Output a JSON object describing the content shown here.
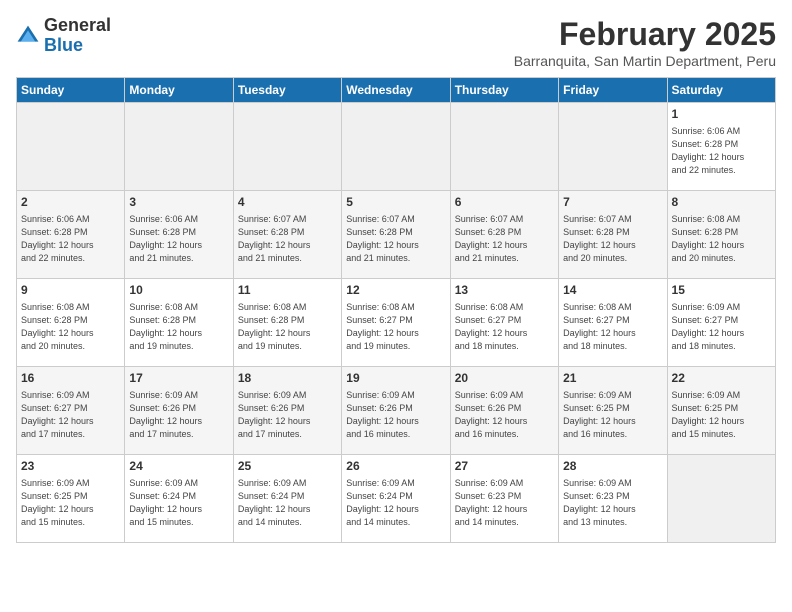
{
  "header": {
    "logo_general": "General",
    "logo_blue": "Blue",
    "month_title": "February 2025",
    "location": "Barranquita, San Martin Department, Peru"
  },
  "days_of_week": [
    "Sunday",
    "Monday",
    "Tuesday",
    "Wednesday",
    "Thursday",
    "Friday",
    "Saturday"
  ],
  "weeks": [
    [
      {
        "day": "",
        "info": ""
      },
      {
        "day": "",
        "info": ""
      },
      {
        "day": "",
        "info": ""
      },
      {
        "day": "",
        "info": ""
      },
      {
        "day": "",
        "info": ""
      },
      {
        "day": "",
        "info": ""
      },
      {
        "day": "1",
        "info": "Sunrise: 6:06 AM\nSunset: 6:28 PM\nDaylight: 12 hours\nand 22 minutes."
      }
    ],
    [
      {
        "day": "2",
        "info": "Sunrise: 6:06 AM\nSunset: 6:28 PM\nDaylight: 12 hours\nand 22 minutes."
      },
      {
        "day": "3",
        "info": "Sunrise: 6:06 AM\nSunset: 6:28 PM\nDaylight: 12 hours\nand 21 minutes."
      },
      {
        "day": "4",
        "info": "Sunrise: 6:07 AM\nSunset: 6:28 PM\nDaylight: 12 hours\nand 21 minutes."
      },
      {
        "day": "5",
        "info": "Sunrise: 6:07 AM\nSunset: 6:28 PM\nDaylight: 12 hours\nand 21 minutes."
      },
      {
        "day": "6",
        "info": "Sunrise: 6:07 AM\nSunset: 6:28 PM\nDaylight: 12 hours\nand 21 minutes."
      },
      {
        "day": "7",
        "info": "Sunrise: 6:07 AM\nSunset: 6:28 PM\nDaylight: 12 hours\nand 20 minutes."
      },
      {
        "day": "8",
        "info": "Sunrise: 6:08 AM\nSunset: 6:28 PM\nDaylight: 12 hours\nand 20 minutes."
      }
    ],
    [
      {
        "day": "9",
        "info": "Sunrise: 6:08 AM\nSunset: 6:28 PM\nDaylight: 12 hours\nand 20 minutes."
      },
      {
        "day": "10",
        "info": "Sunrise: 6:08 AM\nSunset: 6:28 PM\nDaylight: 12 hours\nand 19 minutes."
      },
      {
        "day": "11",
        "info": "Sunrise: 6:08 AM\nSunset: 6:28 PM\nDaylight: 12 hours\nand 19 minutes."
      },
      {
        "day": "12",
        "info": "Sunrise: 6:08 AM\nSunset: 6:27 PM\nDaylight: 12 hours\nand 19 minutes."
      },
      {
        "day": "13",
        "info": "Sunrise: 6:08 AM\nSunset: 6:27 PM\nDaylight: 12 hours\nand 18 minutes."
      },
      {
        "day": "14",
        "info": "Sunrise: 6:08 AM\nSunset: 6:27 PM\nDaylight: 12 hours\nand 18 minutes."
      },
      {
        "day": "15",
        "info": "Sunrise: 6:09 AM\nSunset: 6:27 PM\nDaylight: 12 hours\nand 18 minutes."
      }
    ],
    [
      {
        "day": "16",
        "info": "Sunrise: 6:09 AM\nSunset: 6:27 PM\nDaylight: 12 hours\nand 17 minutes."
      },
      {
        "day": "17",
        "info": "Sunrise: 6:09 AM\nSunset: 6:26 PM\nDaylight: 12 hours\nand 17 minutes."
      },
      {
        "day": "18",
        "info": "Sunrise: 6:09 AM\nSunset: 6:26 PM\nDaylight: 12 hours\nand 17 minutes."
      },
      {
        "day": "19",
        "info": "Sunrise: 6:09 AM\nSunset: 6:26 PM\nDaylight: 12 hours\nand 16 minutes."
      },
      {
        "day": "20",
        "info": "Sunrise: 6:09 AM\nSunset: 6:26 PM\nDaylight: 12 hours\nand 16 minutes."
      },
      {
        "day": "21",
        "info": "Sunrise: 6:09 AM\nSunset: 6:25 PM\nDaylight: 12 hours\nand 16 minutes."
      },
      {
        "day": "22",
        "info": "Sunrise: 6:09 AM\nSunset: 6:25 PM\nDaylight: 12 hours\nand 15 minutes."
      }
    ],
    [
      {
        "day": "23",
        "info": "Sunrise: 6:09 AM\nSunset: 6:25 PM\nDaylight: 12 hours\nand 15 minutes."
      },
      {
        "day": "24",
        "info": "Sunrise: 6:09 AM\nSunset: 6:24 PM\nDaylight: 12 hours\nand 15 minutes."
      },
      {
        "day": "25",
        "info": "Sunrise: 6:09 AM\nSunset: 6:24 PM\nDaylight: 12 hours\nand 14 minutes."
      },
      {
        "day": "26",
        "info": "Sunrise: 6:09 AM\nSunset: 6:24 PM\nDaylight: 12 hours\nand 14 minutes."
      },
      {
        "day": "27",
        "info": "Sunrise: 6:09 AM\nSunset: 6:23 PM\nDaylight: 12 hours\nand 14 minutes."
      },
      {
        "day": "28",
        "info": "Sunrise: 6:09 AM\nSunset: 6:23 PM\nDaylight: 12 hours\nand 13 minutes."
      },
      {
        "day": "",
        "info": ""
      }
    ]
  ]
}
